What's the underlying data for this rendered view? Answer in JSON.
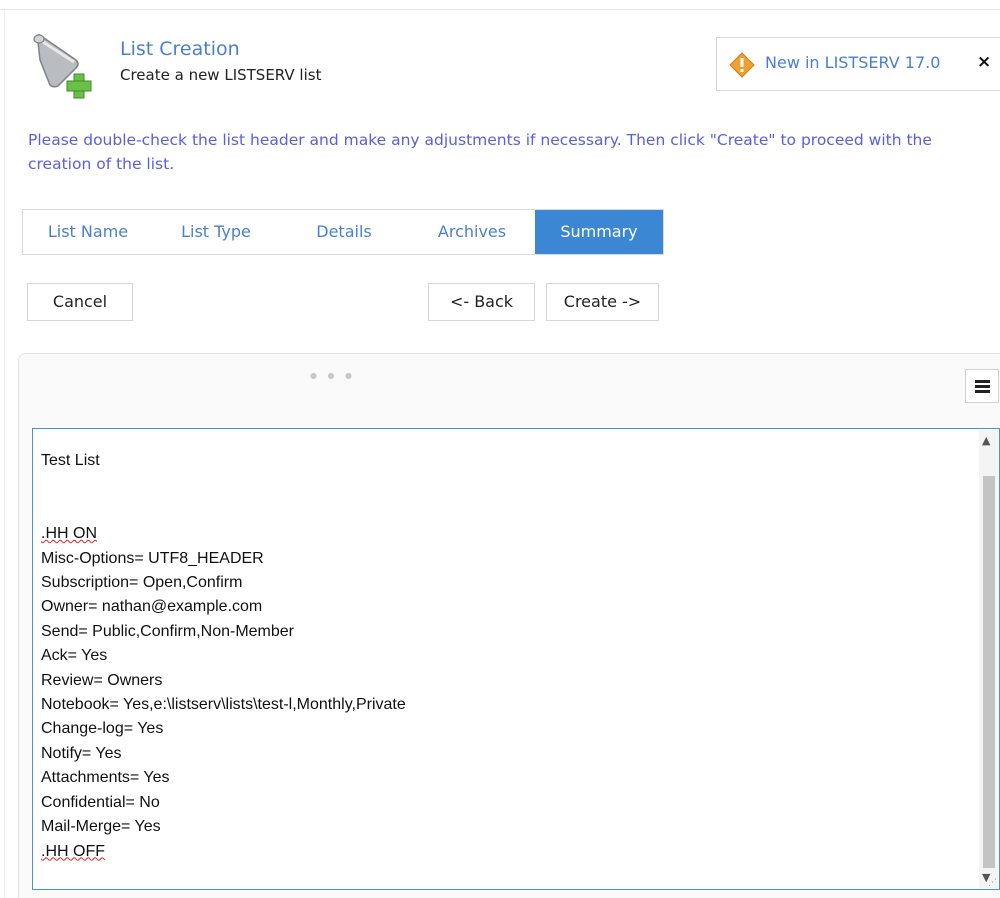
{
  "header": {
    "title": "List Creation",
    "subtitle": "Create a new LISTSERV list",
    "logo_icon": "scroll-plus-icon"
  },
  "notice": {
    "text": "New in LISTSERV 17.0",
    "close": "×",
    "icon": "warning-diamond-icon",
    "accent": "#f0a030"
  },
  "instructions": "Please double-check the list header and make any adjustments if necessary. Then click \"Create\" to proceed with the creation of the list.",
  "tabs": [
    {
      "label": "List Name"
    },
    {
      "label": "List Type"
    },
    {
      "label": "Details"
    },
    {
      "label": "Archives"
    },
    {
      "label": "Summary",
      "active": true
    }
  ],
  "buttons": {
    "cancel": "Cancel",
    "back": "<- Back",
    "create": "Create ->"
  },
  "editor": {
    "lines": [
      "Test List",
      "",
      "",
      ".HH ON",
      "Misc-Options= UTF8_HEADER",
      "Subscription= Open,Confirm",
      "Owner= nathan@example.com",
      "Send= Public,Confirm,Non-Member",
      "Ack= Yes",
      "Review= Owners",
      "Notebook= Yes,e:\\listserv\\lists\\test-l,Monthly,Private",
      "Change-log= Yes",
      "Notify= Yes",
      "Attachments= Yes",
      "Confidential= No",
      "Mail-Merge= Yes",
      ".HH OFF"
    ]
  },
  "colors": {
    "link": "#4a7fd0",
    "instructions": "#5a5ee0",
    "active_tab": "#3b87d4",
    "editor_border": "#4a8fe0"
  }
}
